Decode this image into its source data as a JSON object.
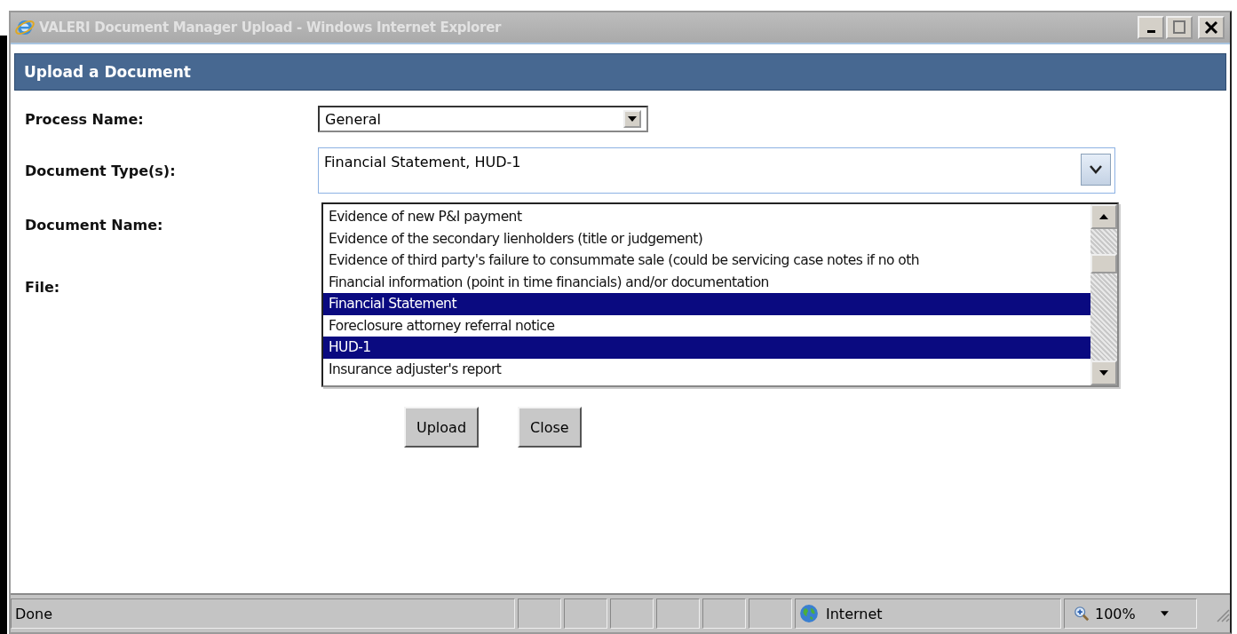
{
  "window": {
    "title": "VALERI Document Manager Upload - Windows Internet Explorer"
  },
  "header": "Upload a Document",
  "form": {
    "process_name": {
      "label": "Process Name:",
      "value": "General"
    },
    "document_types": {
      "label": "Document Type(s):",
      "value": "Financial Statement, HUD-1",
      "expanded": true,
      "options": [
        {
          "label": "Evidence of new P&I payment",
          "selected": false
        },
        {
          "label": "Evidence of the secondary lienholders (title or judgement)",
          "selected": false
        },
        {
          "label": "Evidence of third party's failure to consummate sale (could be servicing case notes if no oth",
          "selected": false
        },
        {
          "label": "Financial information (point in time financials) and/or documentation",
          "selected": false
        },
        {
          "label": "Financial Statement",
          "selected": true
        },
        {
          "label": "Foreclosure attorney referral notice",
          "selected": false
        },
        {
          "label": "HUD-1",
          "selected": true
        },
        {
          "label": "Insurance adjuster's report",
          "selected": false
        }
      ]
    },
    "document_name": {
      "label": "Document Name:"
    },
    "file": {
      "label": "File:"
    }
  },
  "buttons": [
    "Upload",
    "Close"
  ],
  "status_bar": {
    "text": "Done",
    "zone": "Internet",
    "zoom": "100%"
  }
}
